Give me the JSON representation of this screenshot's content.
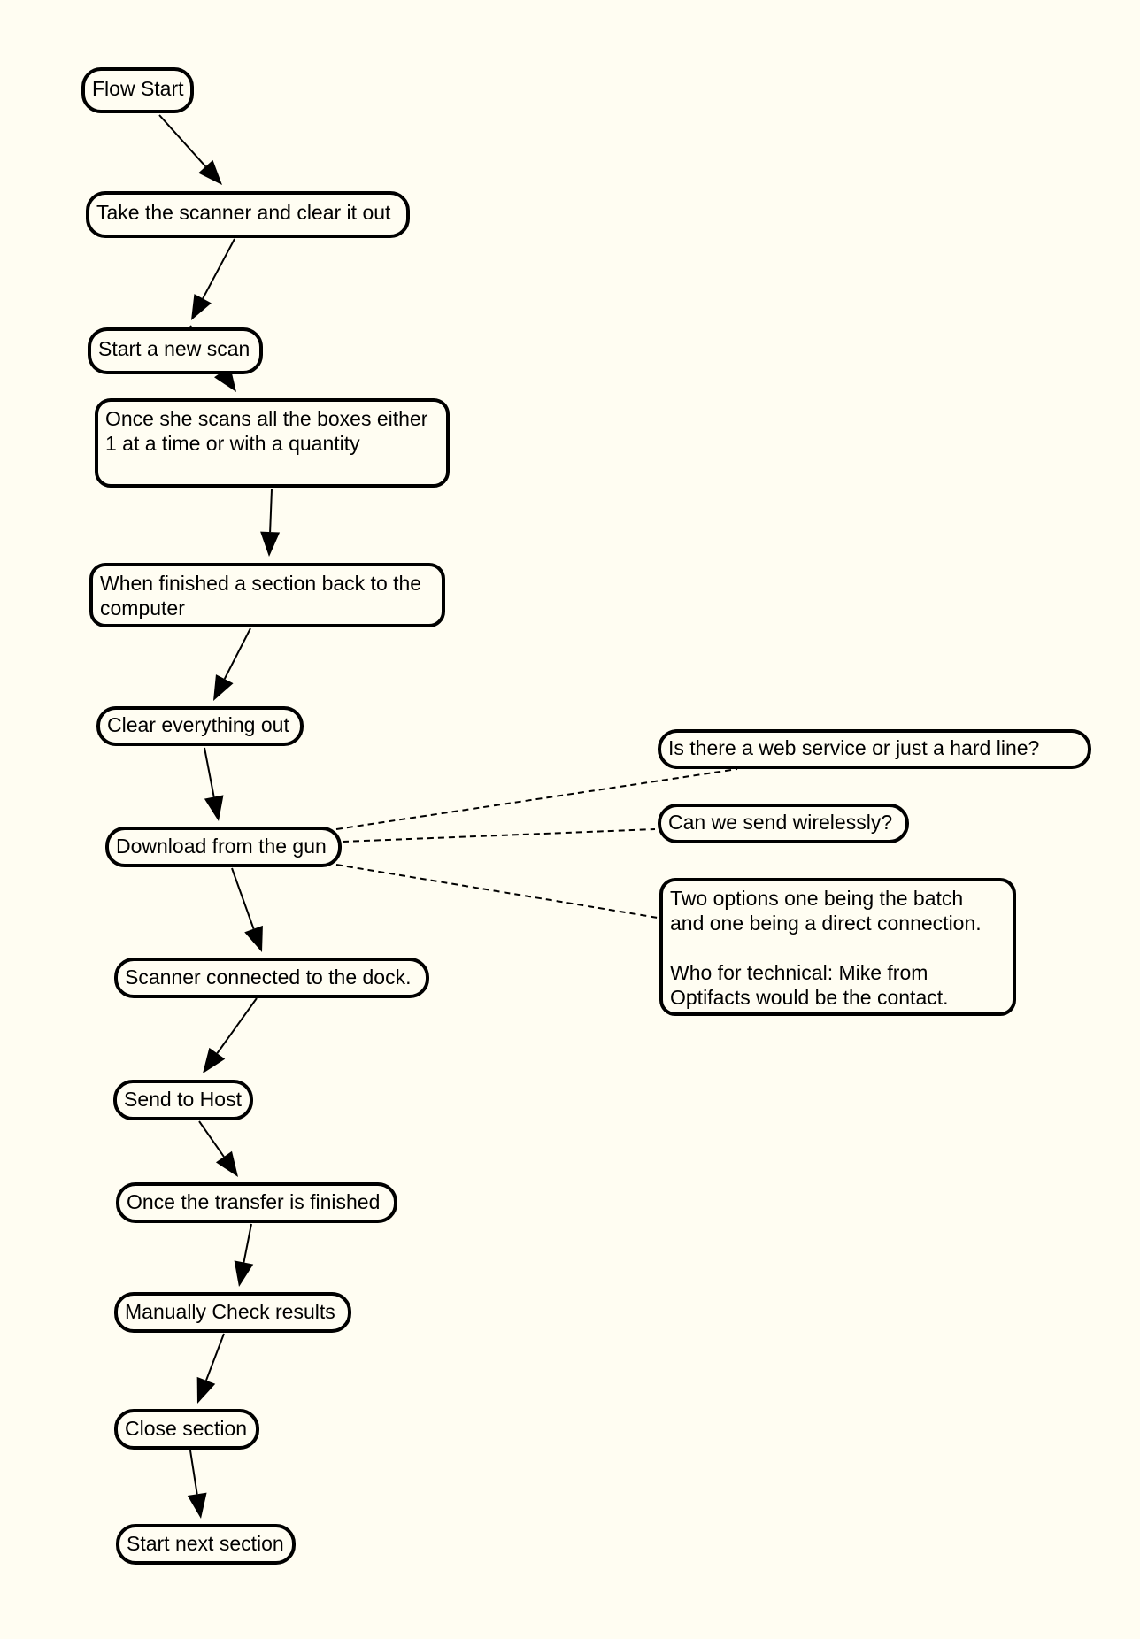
{
  "diagram": {
    "type": "flowchart",
    "colors": {
      "background": "#fffdf2",
      "stroke": "#000000"
    },
    "nodes": [
      {
        "id": "flow-start",
        "lines": [
          "Flow Start"
        ]
      },
      {
        "id": "take-scanner",
        "lines": [
          "Take the scanner and clear it out"
        ]
      },
      {
        "id": "start-new-scan",
        "lines": [
          "Start a new scan"
        ]
      },
      {
        "id": "scan-boxes",
        "lines": [
          "Once she scans all the boxes either",
          "1 at a time or with a quantity"
        ]
      },
      {
        "id": "back-to-computer",
        "lines": [
          "When finished a section back to the",
          "computer"
        ]
      },
      {
        "id": "clear-everything",
        "lines": [
          "Clear everything out"
        ]
      },
      {
        "id": "download-gun",
        "lines": [
          "Download from the gun"
        ]
      },
      {
        "id": "scanner-dock",
        "lines": [
          "Scanner connected to the dock."
        ]
      },
      {
        "id": "send-host",
        "lines": [
          "Send to Host"
        ]
      },
      {
        "id": "transfer-finished",
        "lines": [
          "Once the transfer is finished"
        ]
      },
      {
        "id": "check-results",
        "lines": [
          "Manually Check results"
        ]
      },
      {
        "id": "close-section",
        "lines": [
          "Close section"
        ]
      },
      {
        "id": "start-next",
        "lines": [
          "Start next section"
        ]
      },
      {
        "id": "note-web-service",
        "lines": [
          "Is there a web service or just a hard line?"
        ]
      },
      {
        "id": "note-wireless",
        "lines": [
          "Can we send wirelessly?"
        ]
      },
      {
        "id": "note-two-options",
        "lines": [
          "Two options one being the batch",
          "and one being a direct connection.",
          "",
          "Who for technical: Mike from",
          "Optifacts would be the contact."
        ]
      }
    ],
    "edges": [
      {
        "from": "flow-start",
        "to": "take-scanner",
        "style": "arrow"
      },
      {
        "from": "take-scanner",
        "to": "start-new-scan",
        "style": "arrow"
      },
      {
        "from": "start-new-scan",
        "to": "scan-boxes",
        "style": "arrow"
      },
      {
        "from": "scan-boxes",
        "to": "back-to-computer",
        "style": "arrow"
      },
      {
        "from": "back-to-computer",
        "to": "clear-everything",
        "style": "arrow"
      },
      {
        "from": "clear-everything",
        "to": "download-gun",
        "style": "arrow"
      },
      {
        "from": "download-gun",
        "to": "scanner-dock",
        "style": "arrow"
      },
      {
        "from": "scanner-dock",
        "to": "send-host",
        "style": "arrow"
      },
      {
        "from": "send-host",
        "to": "transfer-finished",
        "style": "arrow"
      },
      {
        "from": "transfer-finished",
        "to": "check-results",
        "style": "arrow"
      },
      {
        "from": "check-results",
        "to": "close-section",
        "style": "arrow"
      },
      {
        "from": "close-section",
        "to": "start-next",
        "style": "arrow"
      },
      {
        "from": "download-gun",
        "to": "note-web-service",
        "style": "dashed"
      },
      {
        "from": "download-gun",
        "to": "note-wireless",
        "style": "dashed"
      },
      {
        "from": "download-gun",
        "to": "note-two-options",
        "style": "dashed"
      }
    ]
  }
}
